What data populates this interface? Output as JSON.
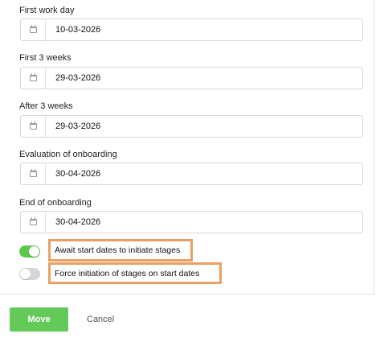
{
  "fields": [
    {
      "label": "First work day",
      "value": "10-03-2026"
    },
    {
      "label": "First 3 weeks",
      "value": "29-03-2026"
    },
    {
      "label": "After 3 weeks",
      "value": "29-03-2026"
    },
    {
      "label": "Evaluation of onboarding",
      "value": "30-04-2026"
    },
    {
      "label": "End of onboarding",
      "value": "30-04-2026"
    }
  ],
  "options": [
    {
      "label": "Await start dates to initiate stages",
      "enabled": true
    },
    {
      "label": "Force initiation of stages on start dates",
      "enabled": false
    }
  ],
  "colors": {
    "toggle_on": "#5cc94e",
    "toggle_off": "#d6d6d6",
    "primary_button": "#63c958",
    "highlight_border": "#e9a064"
  },
  "actions": {
    "move_label": "Move",
    "cancel_label": "Cancel"
  }
}
